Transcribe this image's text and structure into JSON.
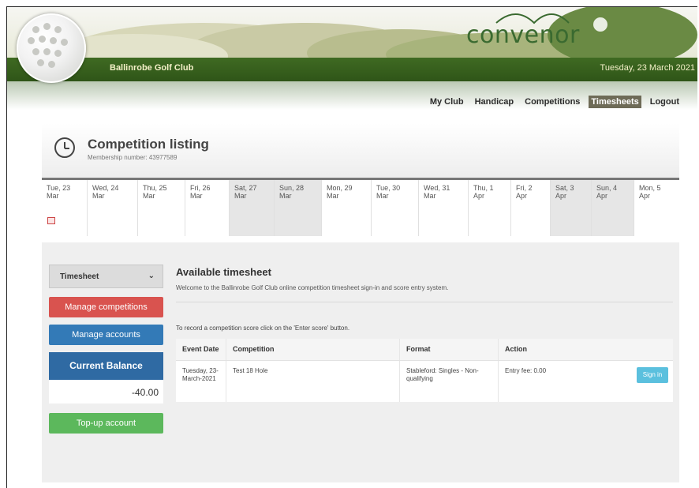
{
  "header": {
    "club_name": "Ballinrobe Golf Club",
    "date": "Tuesday, 23 March 2021",
    "logo": "convenor"
  },
  "nav": {
    "items": [
      {
        "label": "My Club",
        "active": false
      },
      {
        "label": "Handicap",
        "active": false
      },
      {
        "label": "Competitions",
        "active": false
      },
      {
        "label": "Timesheets",
        "active": true
      },
      {
        "label": "Logout",
        "active": false
      }
    ]
  },
  "page": {
    "title": "Competition listing",
    "membership": "Membership number: 43977589",
    "icon": "clock-icon"
  },
  "dates": [
    {
      "day": "Tue, 23",
      "month": "Mar",
      "weekend": false,
      "calendar": true
    },
    {
      "day": "Wed, 24",
      "month": "Mar",
      "weekend": false
    },
    {
      "day": "Thu, 25",
      "month": "Mar",
      "weekend": false
    },
    {
      "day": "Fri, 26",
      "month": "Mar",
      "weekend": false
    },
    {
      "day": "Sat, 27",
      "month": "Mar",
      "weekend": true
    },
    {
      "day": "Sun, 28",
      "month": "Mar",
      "weekend": true
    },
    {
      "day": "Mon, 29",
      "month": "Mar",
      "weekend": false
    },
    {
      "day": "Tue, 30",
      "month": "Mar",
      "weekend": false
    },
    {
      "day": "Wed, 31",
      "month": "Mar",
      "weekend": false
    },
    {
      "day": "Thu, 1",
      "month": "Apr",
      "weekend": false
    },
    {
      "day": "Fri, 2",
      "month": "Apr",
      "weekend": false
    },
    {
      "day": "Sat, 3",
      "month": "Apr",
      "weekend": true
    },
    {
      "day": "Sun, 4",
      "month": "Apr",
      "weekend": true
    },
    {
      "day": "Mon, 5",
      "month": "Apr",
      "weekend": false
    }
  ],
  "sidebar": {
    "select_value": "Timesheet",
    "manage_competitions": "Manage competitions",
    "manage_accounts": "Manage accounts",
    "balance_label": "Current Balance",
    "balance_value": "-40.00",
    "topup": "Top-up account"
  },
  "main": {
    "title": "Available timesheet",
    "welcome": "Welcome to the Ballinrobe Golf Club online competition timesheet sign-in and score entry system.",
    "record": "To record a competition score click on the 'Enter score' button.",
    "columns": [
      "Event Date",
      "Competition",
      "Format",
      "Action"
    ],
    "rows": [
      {
        "date": "Tuesday, 23-March-2021",
        "competition": "Test 18 Hole",
        "format": "Stableford: Singles - Non-qualifying",
        "fee": "Entry fee: 0.00",
        "button": "Sign in"
      }
    ]
  },
  "colors": {
    "green_bar": "#2f5518",
    "red": "#d9534f",
    "blue": "#337ab7",
    "navy": "#2f6aa3",
    "green": "#5cb85c",
    "cyan": "#5bc0de",
    "active_nav": "#6e6b57"
  }
}
